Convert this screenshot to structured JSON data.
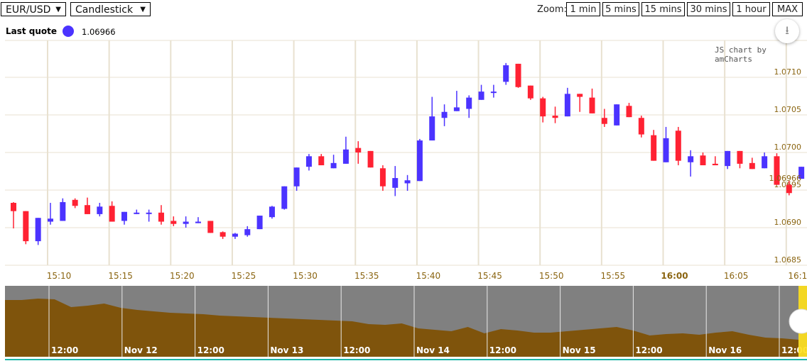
{
  "controls": {
    "pair": "EUR/USD",
    "chart_type": "Candlestick",
    "dropdown_arrow": "▼"
  },
  "last_quote": {
    "label": "Last quote",
    "value": "1.06966",
    "dot_color": "#4b33ff"
  },
  "zoom": {
    "label": "Zoom:",
    "buttons": [
      "1 min",
      "5 mins",
      "15 mins",
      "30 mins",
      "1 hour",
      "MAX"
    ]
  },
  "export_icon": "download-icon",
  "export_glyph": "⭳",
  "credit": "JS chart by amCharts",
  "colors": {
    "up": "#4b33ff",
    "down": "#ff2233",
    "grid": "#e8e1d0",
    "axis_text": "#8a6410",
    "navigator_fill": "#7f540c",
    "navigator_bg": "#808080",
    "selection": "#ffe01a"
  },
  "chart_data": {
    "type": "candlestick",
    "ylim": [
      1.0685,
      1.0713
    ],
    "yticks": [
      "1.0685",
      "1.0690",
      "1.0695",
      "1.0700",
      "1.0705",
      "1.0710"
    ],
    "xticks": [
      "15:10",
      "15:15",
      "15:20",
      "15:25",
      "15:30",
      "15:35",
      "15:40",
      "15:45",
      "15:50",
      "15:55",
      "16:00",
      "16:05",
      "16:1"
    ],
    "xtick_bold": "16:00",
    "guide_label": "1.06966",
    "columns": [
      "time",
      "open",
      "high",
      "low",
      "close"
    ],
    "candles": [
      [
        "15:07",
        1.06933,
        1.06934,
        1.06899,
        1.06922
      ],
      [
        "15:08",
        1.06922,
        1.06922,
        1.06878,
        1.06882
      ],
      [
        "15:09",
        1.06882,
        1.06913,
        1.06877,
        1.06913
      ],
      [
        "15:10",
        1.06908,
        1.06933,
        1.06904,
        1.06912
      ],
      [
        "15:11",
        1.06909,
        1.06939,
        1.06909,
        1.06934
      ],
      [
        "15:12",
        1.06937,
        1.06939,
        1.06926,
        1.06929
      ],
      [
        "15:13",
        1.0693,
        1.0694,
        1.06918,
        1.06918
      ],
      [
        "15:14",
        1.06918,
        1.06933,
        1.06915,
        1.06928
      ],
      [
        "15:15",
        1.06929,
        1.06935,
        1.06908,
        1.06908
      ],
      [
        "15:16",
        1.06909,
        1.06921,
        1.06904,
        1.06921
      ],
      [
        "15:17",
        1.06919,
        1.06924,
        1.06918,
        1.0692
      ],
      [
        "15:18",
        1.06919,
        1.06924,
        1.06908,
        1.0692
      ],
      [
        "15:19",
        1.0692,
        1.0693,
        1.06904,
        1.06908
      ],
      [
        "15:20",
        1.06909,
        1.06915,
        1.06902,
        1.06905
      ],
      [
        "15:21",
        1.06905,
        1.06915,
        1.069,
        1.06908
      ],
      [
        "15:22",
        1.06906,
        1.06914,
        1.06906,
        1.06908
      ],
      [
        "15:23",
        1.06909,
        1.06909,
        1.06893,
        1.06893
      ],
      [
        "15:24",
        1.06894,
        1.06895,
        1.06885,
        1.06888
      ],
      [
        "15:25",
        1.06888,
        1.06893,
        1.06885,
        1.06892
      ],
      [
        "15:26",
        1.0689,
        1.06902,
        1.06888,
        1.06898
      ],
      [
        "15:27",
        1.06898,
        1.06916,
        1.06898,
        1.06916
      ],
      [
        "15:28",
        1.06914,
        1.06929,
        1.06912,
        1.06928
      ],
      [
        "15:29",
        1.06925,
        1.06955,
        1.06924,
        1.06955
      ],
      [
        "15:30",
        1.06955,
        1.0698,
        1.06949,
        1.0698
      ],
      [
        "15:31",
        1.06981,
        1.06998,
        1.06976,
        1.06995
      ],
      [
        "15:32",
        1.06995,
        1.06998,
        1.06983,
        1.06983
      ],
      [
        "15:33",
        1.06979,
        1.06997,
        1.06979,
        1.06986
      ],
      [
        "15:34",
        1.06985,
        1.07021,
        1.06985,
        1.07004
      ],
      [
        "15:35",
        1.07006,
        1.07015,
        1.06985,
        1.07
      ],
      [
        "15:36",
        1.07002,
        1.07002,
        1.0698,
        1.0698
      ],
      [
        "15:37",
        1.06979,
        1.06983,
        1.06949,
        1.06955
      ],
      [
        "15:38",
        1.06953,
        1.06982,
        1.06942,
        1.06966
      ],
      [
        "15:39",
        1.06959,
        1.0697,
        1.06949,
        1.06963
      ],
      [
        "15:40",
        1.06962,
        1.07018,
        1.06962,
        1.07016
      ],
      [
        "15:41",
        1.07016,
        1.07074,
        1.07016,
        1.07048
      ],
      [
        "15:42",
        1.07046,
        1.07064,
        1.07035,
        1.07054
      ],
      [
        "15:43",
        1.07055,
        1.07082,
        1.07055,
        1.0706
      ],
      [
        "15:44",
        1.07058,
        1.07076,
        1.07046,
        1.07073
      ],
      [
        "15:45",
        1.0707,
        1.0709,
        1.0707,
        1.07081
      ],
      [
        "15:46",
        1.0708,
        1.0709,
        1.07073,
        1.07081
      ],
      [
        "15:47",
        1.07094,
        1.07119,
        1.0709,
        1.07116
      ],
      [
        "15:48",
        1.07118,
        1.07118,
        1.07086,
        1.07087
      ],
      [
        "15:49",
        1.07089,
        1.07089,
        1.0707,
        1.07072
      ],
      [
        "15:50",
        1.07072,
        1.07074,
        1.0704,
        1.07048
      ],
      [
        "15:51",
        1.07049,
        1.07061,
        1.07039,
        1.07046
      ],
      [
        "15:52",
        1.07048,
        1.07086,
        1.07048,
        1.07078
      ],
      [
        "15:53",
        1.07078,
        1.07078,
        1.07054,
        1.07074
      ],
      [
        "15:54",
        1.07073,
        1.07085,
        1.07052,
        1.07052
      ],
      [
        "15:55",
        1.07046,
        1.07058,
        1.07034,
        1.07038
      ],
      [
        "15:56",
        1.07036,
        1.07064,
        1.07036,
        1.07064
      ],
      [
        "15:57",
        1.07062,
        1.07066,
        1.07047,
        1.07047
      ],
      [
        "15:58",
        1.07046,
        1.07049,
        1.0702,
        1.07024
      ],
      [
        "15:59",
        1.07023,
        1.0703,
        1.06989,
        1.06989
      ],
      [
        "16:00",
        1.06987,
        1.07034,
        1.06987,
        1.07019
      ],
      [
        "16:01",
        1.07029,
        1.07034,
        1.06983,
        1.06989
      ],
      [
        "16:02",
        1.06987,
        1.07003,
        1.06968,
        1.06995
      ],
      [
        "16:03",
        1.06996,
        1.07,
        1.06983,
        1.06983
      ],
      [
        "16:04",
        1.06985,
        1.06995,
        1.06983,
        1.06983
      ],
      [
        "16:05",
        1.06982,
        1.07002,
        1.06978,
        1.07002
      ],
      [
        "16:06",
        1.07002,
        1.07002,
        1.06979,
        1.06985
      ],
      [
        "16:07",
        1.06986,
        1.06993,
        1.06978,
        1.06978
      ],
      [
        "16:08",
        1.06979,
        1.07,
        1.06979,
        1.06995
      ],
      [
        "16:09",
        1.06995,
        1.06999,
        1.06957,
        1.06957
      ],
      [
        "16:10",
        1.06957,
        1.06962,
        1.06943,
        1.06946
      ],
      [
        "16:11",
        1.06965,
        1.06981,
        1.06965,
        1.06981
      ]
    ],
    "navigator": {
      "labels": [
        "12:00",
        "Nov 12",
        "12:00",
        "Nov 13",
        "12:00",
        "Nov 14",
        "12:00",
        "Nov 15",
        "12:00",
        "Nov 16",
        "12:00"
      ],
      "relative_values": [
        80,
        80,
        82,
        81,
        70,
        72,
        75,
        69,
        66,
        64,
        62,
        61,
        60,
        58,
        57,
        56,
        55,
        54,
        53,
        52,
        51,
        50,
        46,
        45,
        47,
        40,
        38,
        36,
        42,
        33,
        39,
        37,
        34,
        34,
        36,
        38,
        40,
        42,
        37,
        30,
        32,
        33,
        31,
        34,
        36,
        31,
        27,
        26,
        24
      ]
    }
  }
}
